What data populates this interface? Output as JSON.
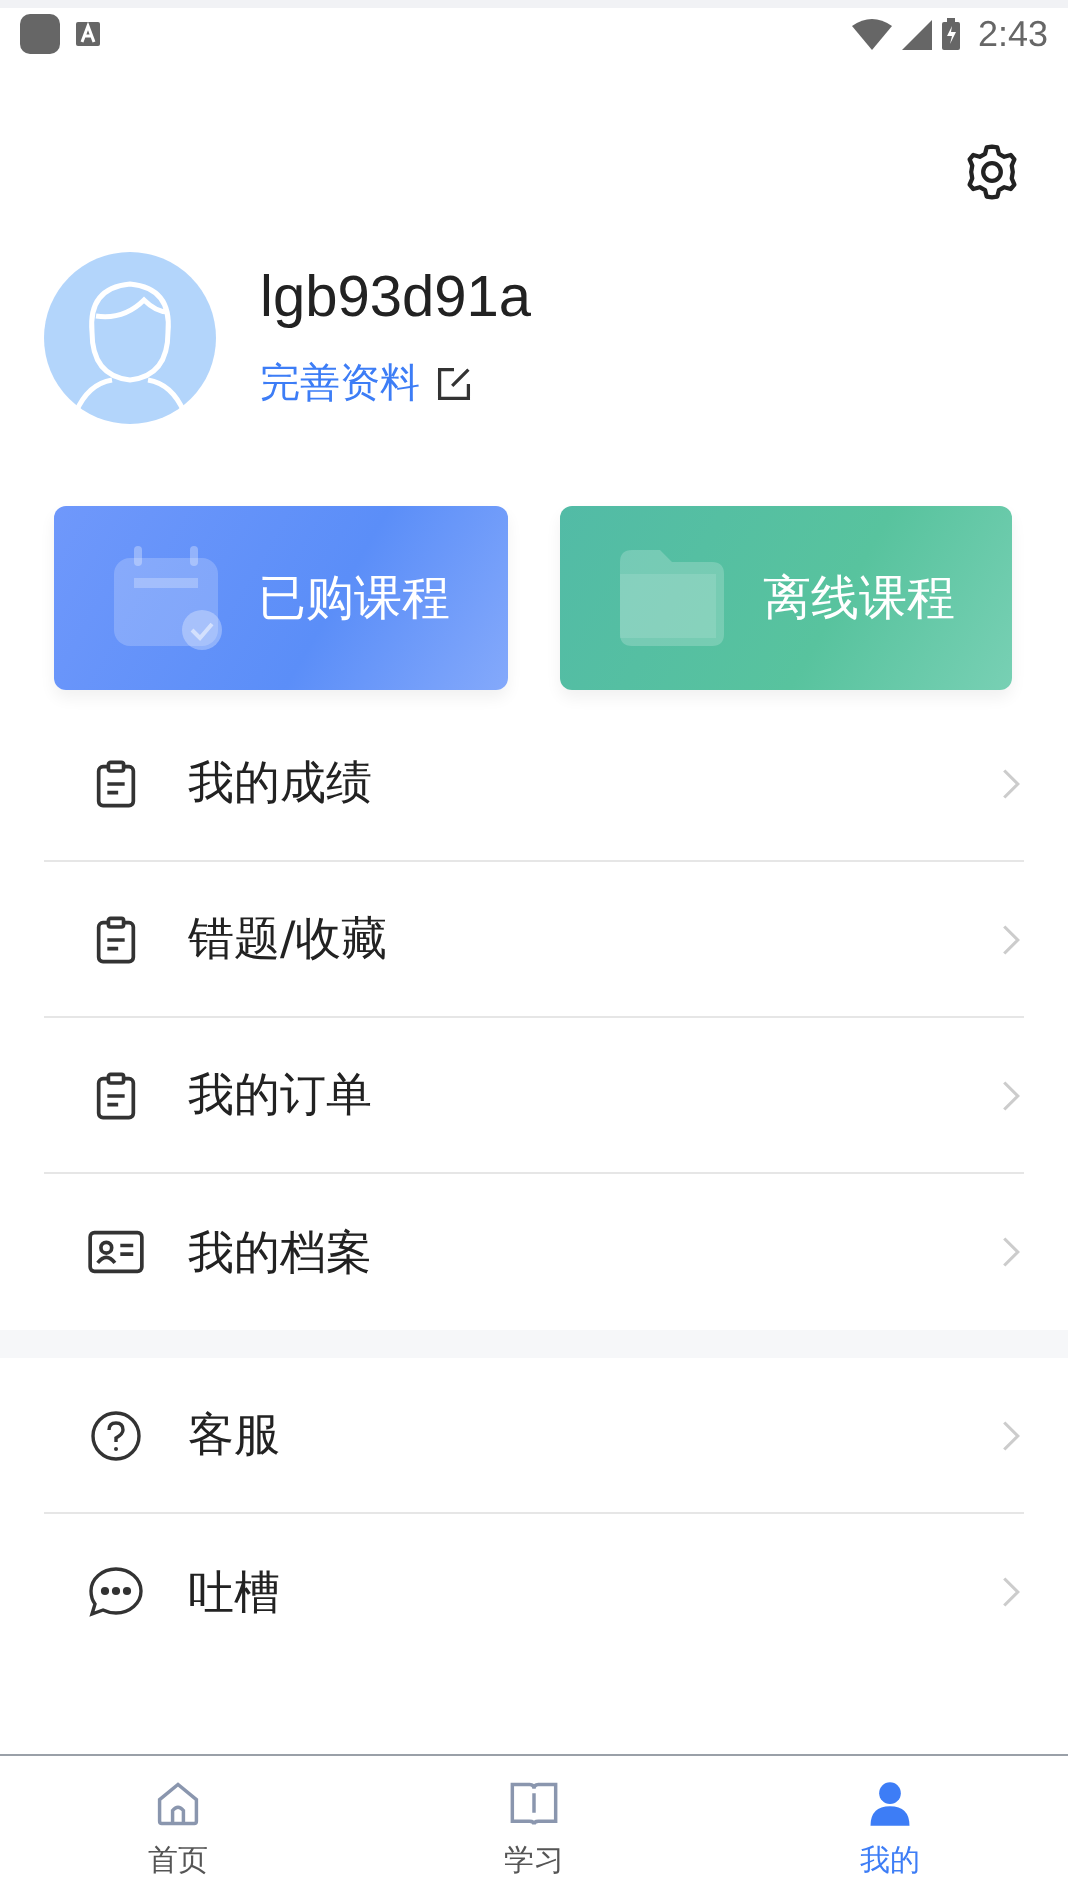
{
  "status_bar": {
    "time": "2:43"
  },
  "profile": {
    "username": "lgb93d91a",
    "edit_link": "完善资料"
  },
  "cards": [
    {
      "label": "已购课程",
      "kind": "purchased"
    },
    {
      "label": "离线课程",
      "kind": "offline"
    }
  ],
  "menu_sections": [
    {
      "items": [
        {
          "label": "我的成绩",
          "kind": "clipboard"
        },
        {
          "label": "错题/收藏",
          "kind": "clipboard"
        },
        {
          "label": "我的订单",
          "kind": "clipboard"
        },
        {
          "label": "我的档案",
          "kind": "idcard"
        }
      ]
    },
    {
      "items": [
        {
          "label": "客服",
          "kind": "help"
        },
        {
          "label": "吐槽",
          "kind": "chat"
        }
      ]
    }
  ],
  "tab_bar": [
    {
      "label": "首页",
      "kind": "home",
      "selected": false
    },
    {
      "label": "学习",
      "kind": "book",
      "selected": false
    },
    {
      "label": "我的",
      "kind": "person",
      "selected": true
    }
  ]
}
